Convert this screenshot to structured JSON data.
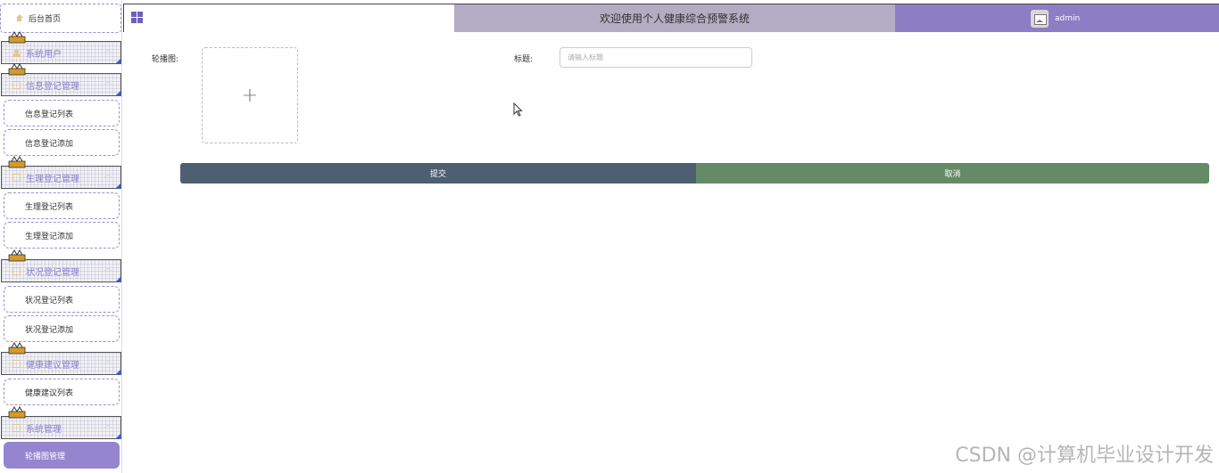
{
  "sidebar": {
    "home": "后台首页",
    "groups": [
      {
        "label": "系统用户",
        "items": []
      },
      {
        "label": "信息登记管理",
        "items": [
          "信息登记列表",
          "信息登记添加"
        ]
      },
      {
        "label": "生理登记管理",
        "items": [
          "生理登记列表",
          "生理登记添加"
        ]
      },
      {
        "label": "状况登记管理",
        "items": [
          "状况登记列表",
          "状况登记添加"
        ]
      },
      {
        "label": "健康建议管理",
        "items": [
          "健康建议列表"
        ]
      },
      {
        "label": "系统管理",
        "items": [
          "轮播图管理"
        ]
      }
    ],
    "active_item": "轮播图管理"
  },
  "header": {
    "title": "欢迎使用个人健康综合预警系统",
    "username": "admin"
  },
  "form": {
    "image_label": "轮播图:",
    "upload_plus": "+",
    "title_label": "标题:",
    "title_placeholder": "请输入标题",
    "title_value": "",
    "submit_label": "提交",
    "cancel_label": "取消"
  },
  "colors": {
    "accent": "#8b7ec4",
    "header_mid": "#b3adc3",
    "submit": "#4d5f70",
    "cancel": "#648b66"
  },
  "watermark": "CSDN @计算机毕业设计开发"
}
